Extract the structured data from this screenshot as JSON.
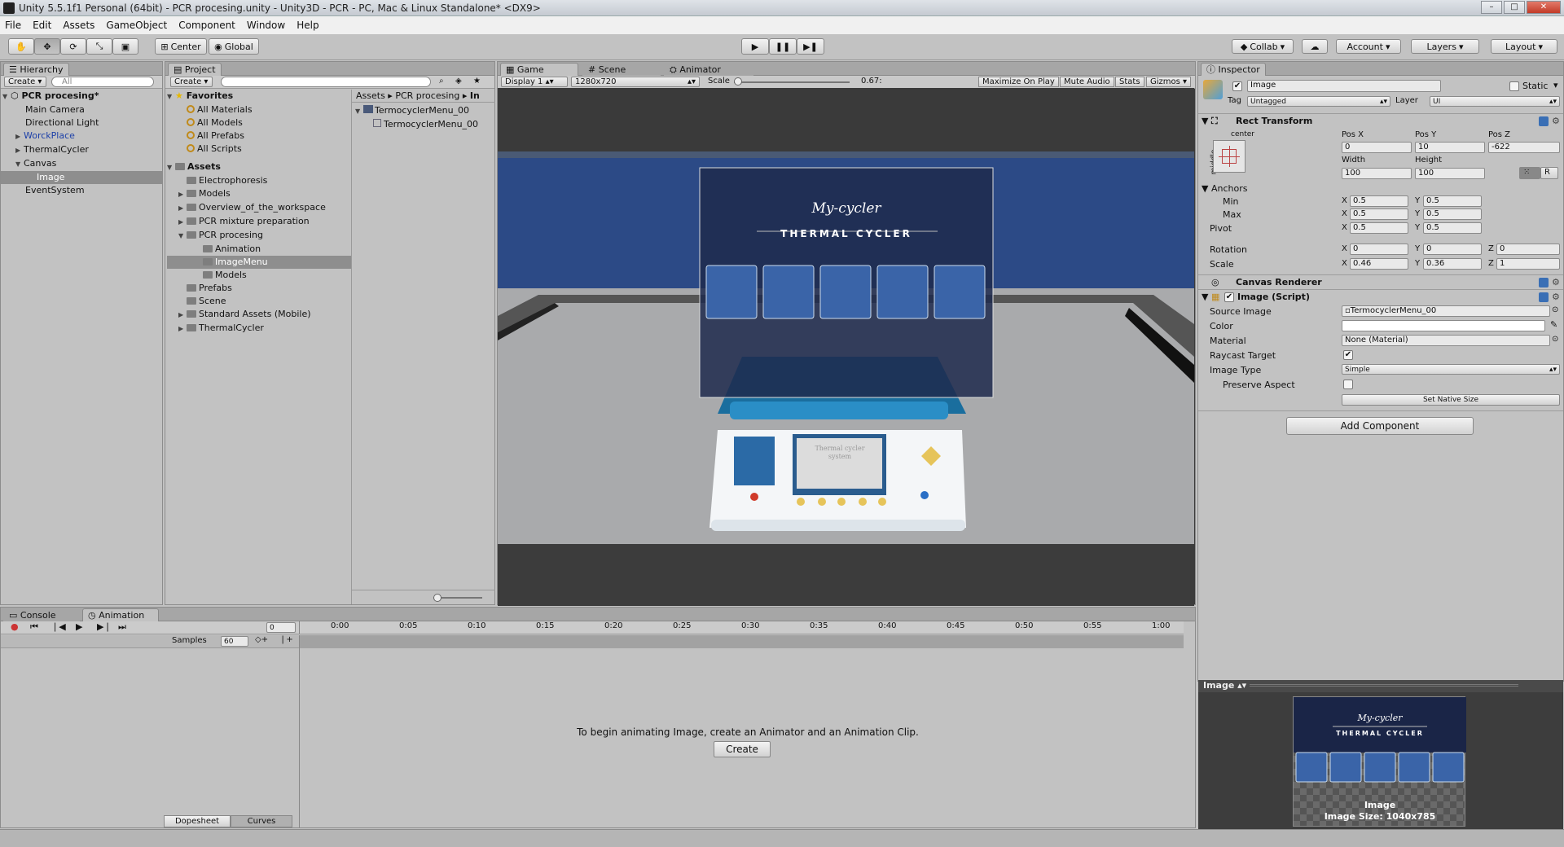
{
  "title": "Unity 5.5.1f1 Personal (64bit) - PCR procesing.unity - Unity3D - PCR - PC, Mac & Linux Standalone* <DX9>",
  "window_buttons": {
    "minimize": "–",
    "maximize": "□",
    "close": "✕"
  },
  "menu": [
    "File",
    "Edit",
    "Assets",
    "GameObject",
    "Component",
    "Window",
    "Help"
  ],
  "toolbar": {
    "pivot": "Center",
    "space": "Global",
    "collab": "Collab",
    "account": "Account",
    "layers": "Layers",
    "layout": "Layout"
  },
  "hierarchy": {
    "tab": "Hierarchy",
    "create": "Create",
    "search_placeholder": "All",
    "scene": "PCR procesing*",
    "items": [
      "Main Camera",
      "Directional Light",
      "WorckPlace",
      "ThermalCycler",
      "Canvas",
      "Image",
      "EventSystem"
    ]
  },
  "project": {
    "tab": "Project",
    "create": "Create",
    "favorites_label": "Favorites",
    "favorites": [
      "All Materials",
      "All Models",
      "All Prefabs",
      "All Scripts"
    ],
    "assets_label": "Assets",
    "folders": [
      "Electrophoresis",
      "Models",
      "Overview_of_the_workspace",
      "PCR mixture preparation",
      "PCR procesing",
      "Animation",
      "ImageMenu",
      "Models",
      "Prefabs",
      "Scene",
      "Standard Assets (Mobile)",
      "ThermalCycler"
    ],
    "breadcrumb": [
      "Assets",
      "PCR procesing",
      "In"
    ],
    "files": [
      "TermocyclerMenu_00",
      "TermocyclerMenu_00"
    ]
  },
  "game": {
    "tabs": [
      "Game",
      "Scene",
      "Animator"
    ],
    "display": "Display 1",
    "resolution": "1280x720",
    "scale_label": "Scale",
    "scale_value": "0.67:",
    "options": [
      "Maximize On Play",
      "Mute Audio",
      "Stats",
      "Gizmos"
    ],
    "menu_title": "My-cycler",
    "menu_subtitle": "THERMAL CYCLER",
    "device_screen_text": "Thermal cycler system"
  },
  "inspector": {
    "tab": "Inspector",
    "name": "Image",
    "static_label": "Static",
    "tag_label": "Tag",
    "tag": "Untagged",
    "layer_label": "Layer",
    "layer": "UI",
    "rect_transform": {
      "title": "Rect Transform",
      "anchor_h": "center",
      "anchor_v": "middle",
      "pos_x_label": "Pos X",
      "pos_y_label": "Pos Y",
      "pos_z_label": "Pos Z",
      "pos_x": "0",
      "pos_y": "10",
      "pos_z": "-622",
      "width_label": "Width",
      "height_label": "Height",
      "width": "100",
      "height": "100",
      "r_btn": "R",
      "anchors_label": "Anchors",
      "min_label": "Min",
      "max_label": "Max",
      "pivot_label": "Pivot",
      "x": "X",
      "y": "Y",
      "z": "Z",
      "min_x": "0.5",
      "min_y": "0.5",
      "max_x": "0.5",
      "max_y": "0.5",
      "pivot_x": "0.5",
      "pivot_y": "0.5",
      "rotation_label": "Rotation",
      "scale_label": "Scale",
      "rot_x": "0",
      "rot_y": "0",
      "rot_z": "0",
      "scale_x": "0.46",
      "scale_y": "0.36",
      "scale_z": "1"
    },
    "canvas_renderer": "Canvas Renderer",
    "image_script": {
      "title": "Image (Script)",
      "source_image_label": "Source Image",
      "source_image": "TermocyclerMenu_00",
      "color_label": "Color",
      "material_label": "Material",
      "material": "None (Material)",
      "raycast_label": "Raycast Target",
      "image_type_label": "Image Type",
      "image_type": "Simple",
      "preserve_label": "Preserve Aspect",
      "native_size_btn": "Set Native Size"
    },
    "add_component": "Add Component",
    "preview_title": "Image",
    "preview_name": "Image",
    "preview_size": "Image Size: 1040x785"
  },
  "bottom": {
    "tabs": [
      "Console",
      "Animation"
    ],
    "frame": "0",
    "samples_label": "Samples",
    "samples": "60",
    "timeline": [
      "0:00",
      "0:05",
      "0:10",
      "0:15",
      "0:20",
      "0:25",
      "0:30",
      "0:35",
      "0:40",
      "0:45",
      "0:50",
      "0:55",
      "1:00"
    ],
    "message": "To begin animating Image, create an Animator and an Animation Clip.",
    "create_btn": "Create",
    "dopesheet": "Dopesheet",
    "curves": "Curves"
  },
  "colors": {
    "selection": "#8e8e8e",
    "link_blue": "#1b3fa8",
    "menu_bg": "#121c3a",
    "sky": "#2c4a86"
  }
}
